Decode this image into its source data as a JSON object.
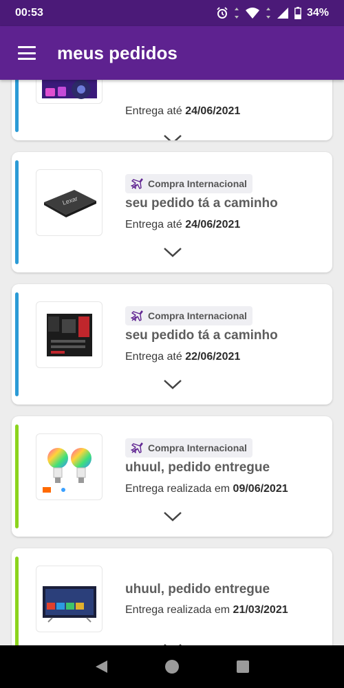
{
  "status_bar": {
    "time": "00:53",
    "battery": "34%"
  },
  "app_bar": {
    "title": "meus pedidos"
  },
  "colors": {
    "primary": "#5e2290",
    "status_bar": "#4b1a78",
    "in_transit": "#2b9bd6",
    "delivered": "#8cd41e"
  },
  "orders": [
    {
      "badge": "",
      "status": "",
      "delivery_prefix": "Entrega até",
      "delivery_date": "24/06/2021"
    },
    {
      "badge": "Compra Internacional",
      "status": "seu pedido tá a caminho",
      "delivery_prefix": "Entrega até",
      "delivery_date": "24/06/2021",
      "image": "ssd-icon"
    },
    {
      "badge": "Compra Internacional",
      "status": "seu pedido tá a caminho",
      "delivery_prefix": "Entrega até",
      "delivery_date": "22/06/2021",
      "image": "motherboard-icon"
    },
    {
      "badge": "Compra Internacional",
      "status": "uhuul, pedido entregue",
      "delivery_prefix": "Entrega realizada em",
      "delivery_date": "09/06/2021",
      "image": "smart-bulbs-icon"
    },
    {
      "badge": "",
      "status": "uhuul, pedido entregue",
      "delivery_prefix": "Entrega realizada em",
      "delivery_date": "21/03/2021",
      "image": "smart-tv-icon"
    }
  ]
}
